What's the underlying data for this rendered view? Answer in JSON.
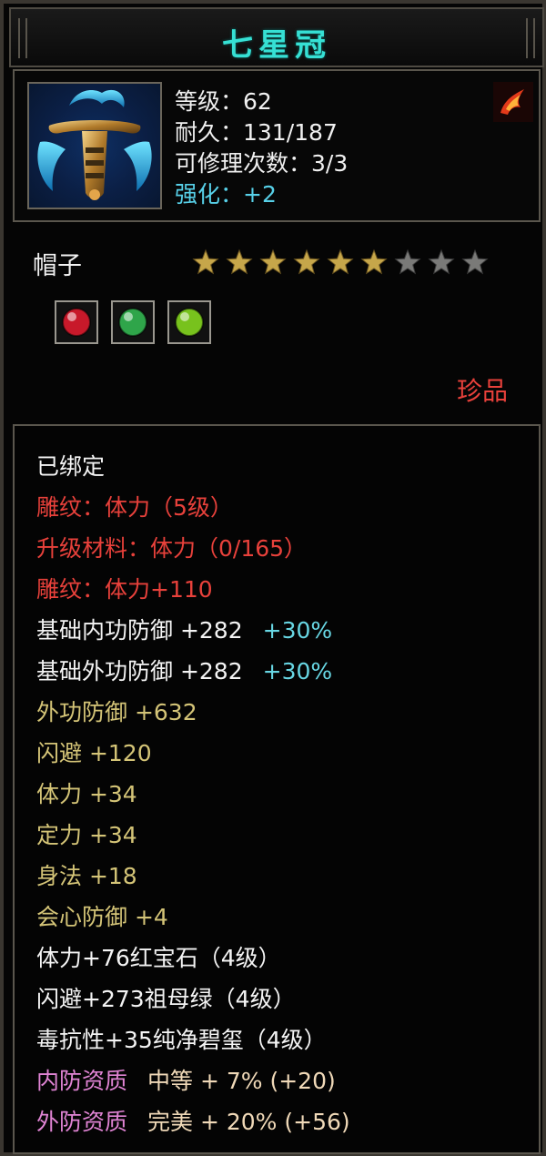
{
  "item": {
    "name": "七星冠",
    "level_line": "等级：62",
    "durability_line": "耐久：131/187",
    "repair_line": "可修理次数：3/3",
    "enhance_line": "强化：+2",
    "type": "帽子",
    "stars_filled": 6,
    "stars_total": 9,
    "quality": "珍品",
    "icon": "crown-helmet-icon",
    "badge_icon": "fire-claw-icon"
  },
  "gems": [
    {
      "icon": "ruby-gem-icon",
      "color": "#c8192a"
    },
    {
      "icon": "emerald-gem-icon",
      "color": "#2fa54a"
    },
    {
      "icon": "jade-gem-icon",
      "color": "#78c21d"
    }
  ],
  "details": [
    {
      "text": "已绑定",
      "color": "#f4f4f4"
    },
    {
      "text": "雕纹：体力（5级）",
      "color": "#e8413b"
    },
    {
      "text": "升级材料：体力（0/165）",
      "color": "#e8413b"
    },
    {
      "text": "雕纹：体力+110",
      "color": "#e8413b"
    },
    {
      "text": "基础内功防御 +282",
      "extra": "+30%",
      "color": "#f4f4f4",
      "extra_color": "#68d7e4"
    },
    {
      "text": "基础外功防御 +282",
      "extra": "+30%",
      "color": "#f4f4f4",
      "extra_color": "#68d7e4"
    },
    {
      "text": "外功防御 +632",
      "color": "#d4c477"
    },
    {
      "text": "闪避 +120",
      "color": "#d4c477"
    },
    {
      "text": "体力 +34",
      "color": "#d4c477"
    },
    {
      "text": "定力 +34",
      "color": "#d4c477"
    },
    {
      "text": "身法 +18",
      "color": "#d4c477"
    },
    {
      "text": "会心防御 +4",
      "color": "#d4c477"
    },
    {
      "text": "体力+76红宝石（4级）",
      "color": "#f4f4f4"
    },
    {
      "text": "闪避+273祖母绿（4级）",
      "color": "#f4f4f4"
    },
    {
      "text": "毒抗性+35纯净碧玺（4级）",
      "color": "#f4f4f4"
    },
    {
      "text": "内防资质",
      "extra": "中等 + 7% (+20)",
      "color": "#e084d4",
      "extra_color": "#f0d9b8"
    },
    {
      "text": "外防资质",
      "extra": "完美 + 20% (+56)",
      "color": "#e084d4",
      "extra_color": "#f0d9b8"
    }
  ],
  "colors": {
    "title": "#36e0d4",
    "enhance": "#57d0e8",
    "quality": "#e8413b",
    "star_filled": "#c6a64a",
    "star_empty": "#7a7a78"
  }
}
